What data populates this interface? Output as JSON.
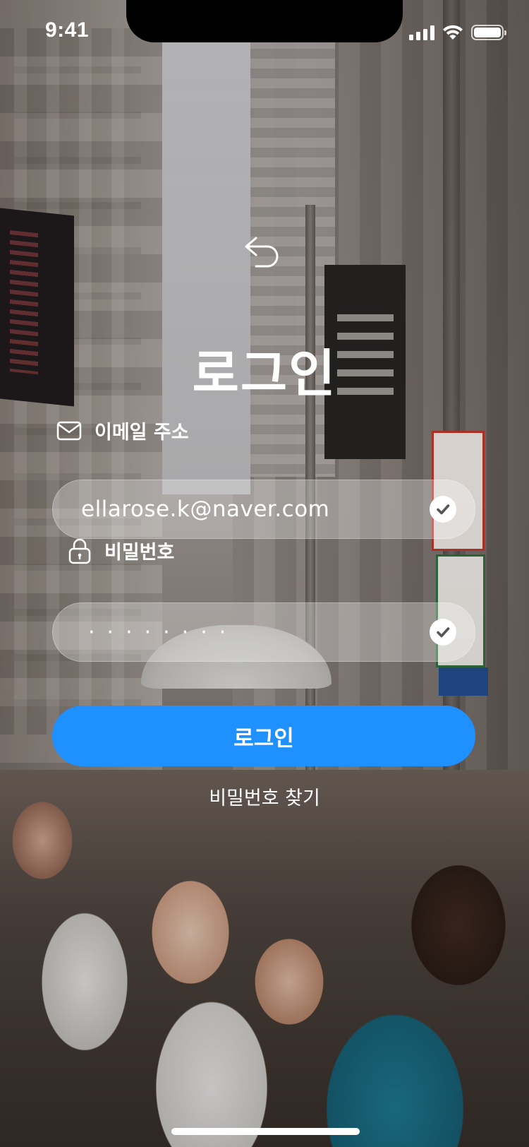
{
  "status_bar": {
    "time": "9:41",
    "icons": [
      "cellular-signal-icon",
      "wifi-icon",
      "battery-icon"
    ]
  },
  "header": {
    "back_icon": "back-arrow-icon",
    "title": "로그인"
  },
  "email": {
    "label": "이메일 주소",
    "icon": "envelope-icon",
    "value": "ellarose.k@naver.com",
    "valid_icon": "check-icon"
  },
  "password": {
    "label": "비밀번호",
    "icon": "lock-icon",
    "masked_value": "········",
    "valid_icon": "check-icon"
  },
  "actions": {
    "login_label": "로그인",
    "forgot_password_label": "비밀번호 찾기"
  },
  "colors": {
    "primary": "#1E90FF",
    "text": "#FFFFFF",
    "input_background": "rgba(255,255,255,0.30)"
  }
}
